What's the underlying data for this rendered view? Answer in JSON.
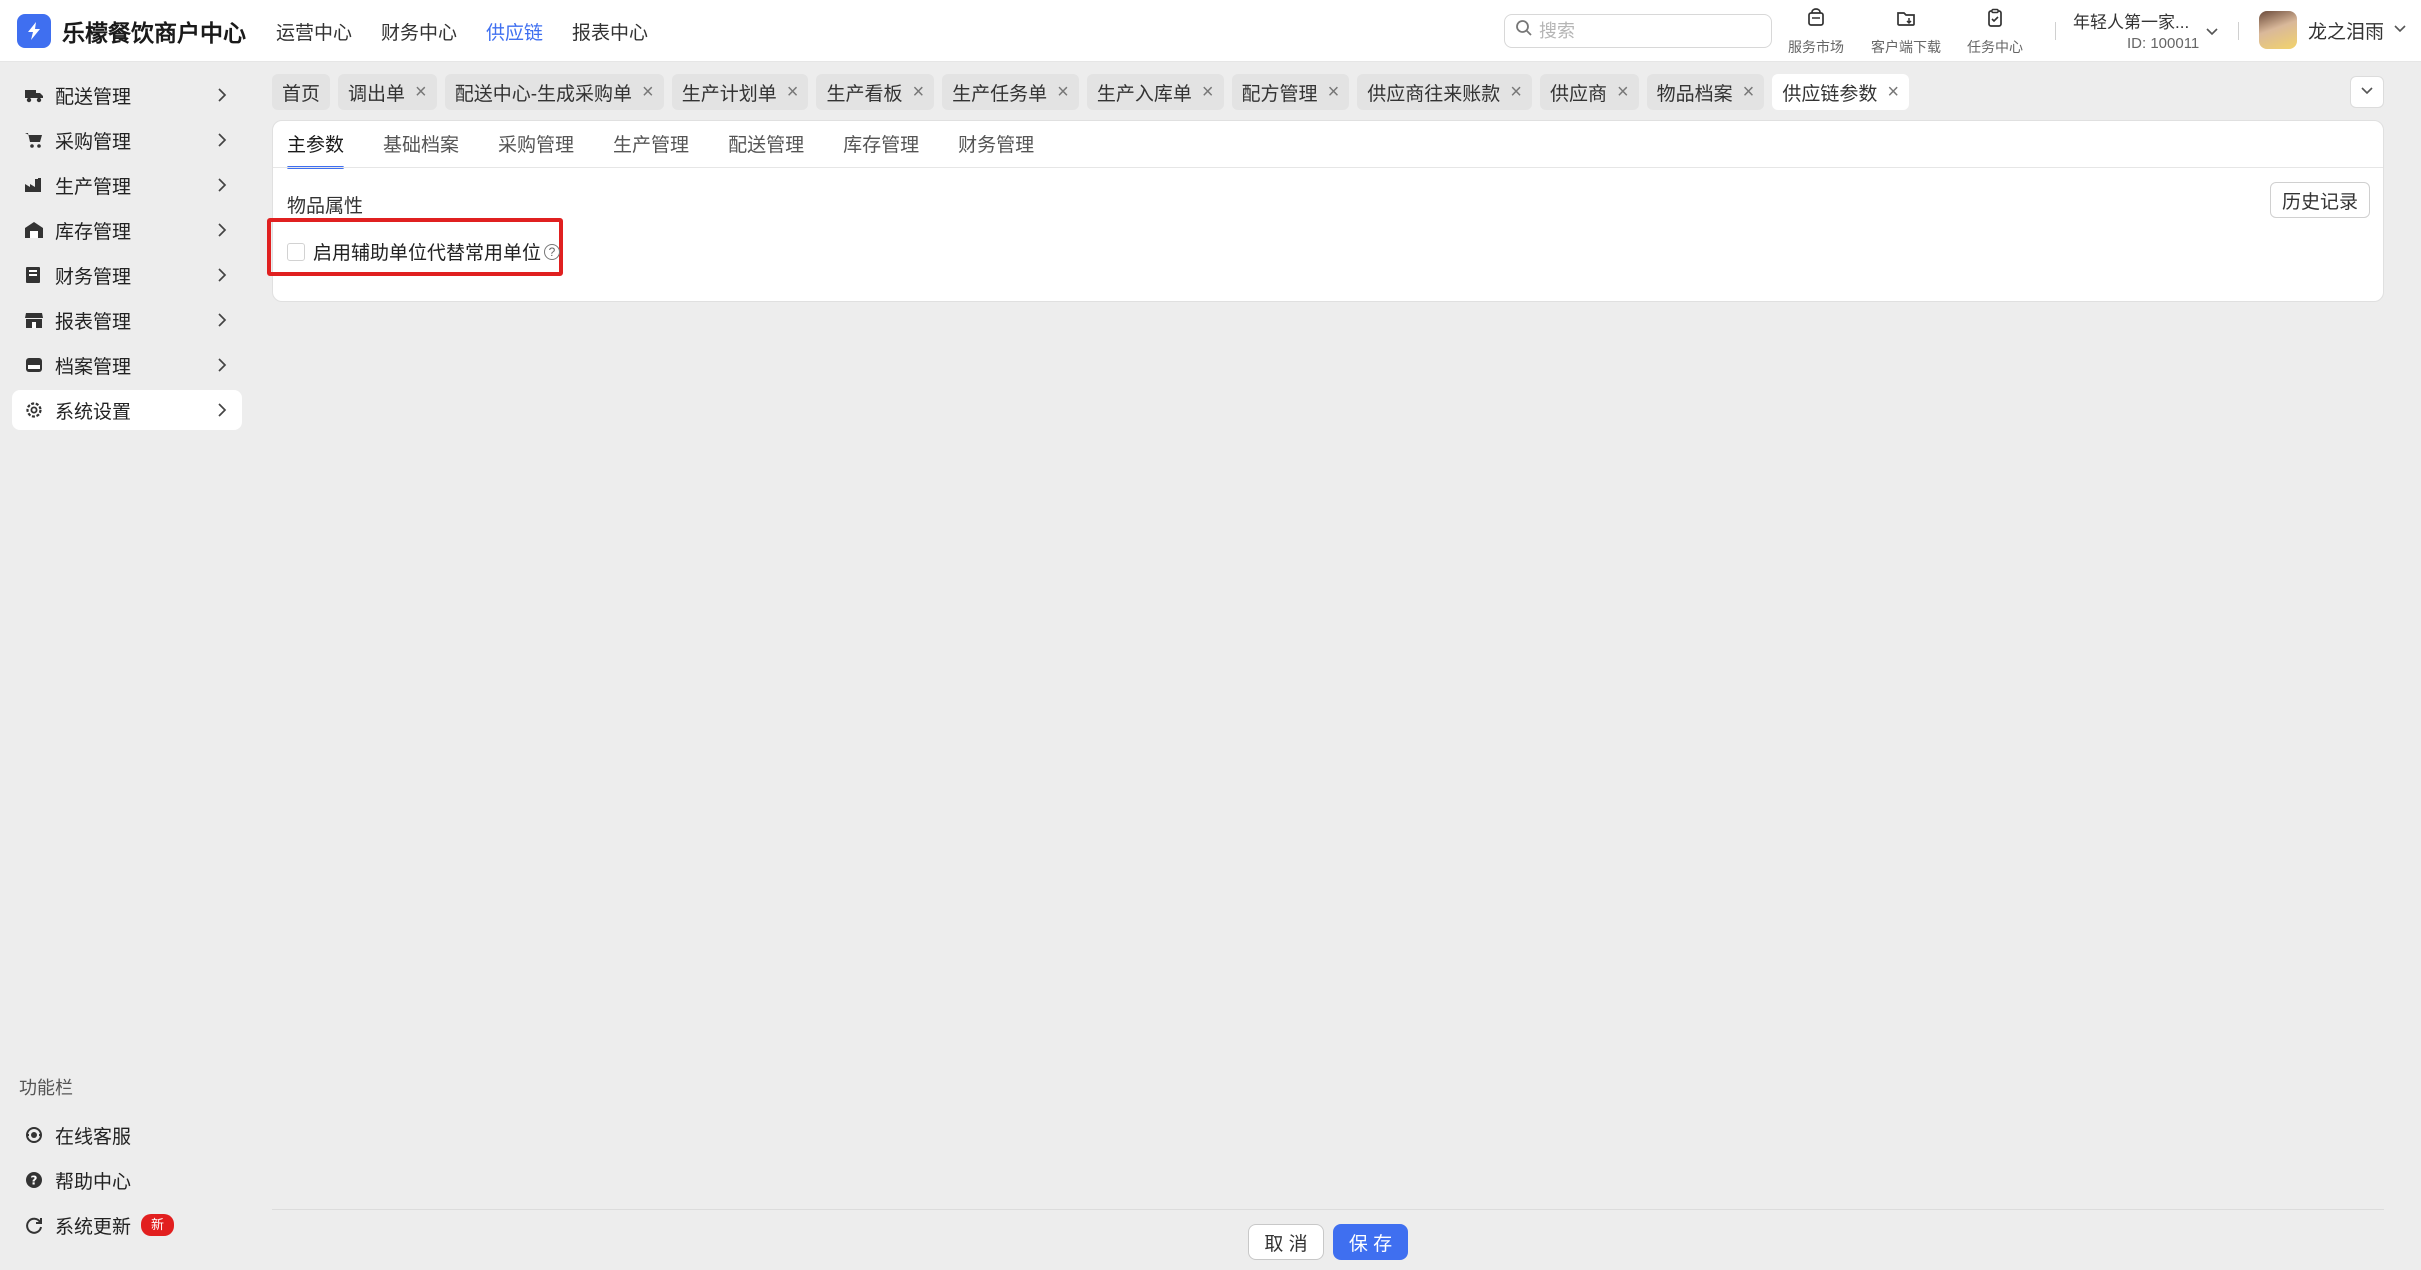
{
  "app": {
    "title": "乐檬餐饮商户中心",
    "brand_color": "#3f6ff0",
    "logo_icon": "lemon-logo-icon"
  },
  "topnav": {
    "items": [
      {
        "label": "运营中心",
        "active": false
      },
      {
        "label": "财务中心",
        "active": false
      },
      {
        "label": "供应链",
        "active": true
      },
      {
        "label": "报表中心",
        "active": false
      }
    ]
  },
  "search": {
    "placeholder": "搜索",
    "value": ""
  },
  "tools": [
    {
      "label": "服务市场",
      "icon": "store-bag-icon"
    },
    {
      "label": "客户端下载",
      "icon": "folder-download-icon"
    },
    {
      "label": "任务中心",
      "icon": "clipboard-icon"
    }
  ],
  "store": {
    "name": "年轻人第一家...",
    "id": "ID: 100011"
  },
  "user": {
    "name": "龙之泪雨"
  },
  "sidebar": {
    "items": [
      {
        "label": "配送管理",
        "icon": "truck-icon",
        "active": false
      },
      {
        "label": "采购管理",
        "icon": "cart-icon",
        "active": false
      },
      {
        "label": "生产管理",
        "icon": "factory-icon",
        "active": false
      },
      {
        "label": "库存管理",
        "icon": "warehouse-icon",
        "active": false
      },
      {
        "label": "财务管理",
        "icon": "ledger-icon",
        "active": false
      },
      {
        "label": "报表管理",
        "icon": "shop-icon",
        "active": false
      },
      {
        "label": "档案管理",
        "icon": "archive-box-icon",
        "active": false
      },
      {
        "label": "系统设置",
        "icon": "gear-icon",
        "active": true
      }
    ],
    "func_title": "功能栏",
    "func_items": [
      {
        "label": "在线客服",
        "icon": "headset-icon"
      },
      {
        "label": "帮助中心",
        "icon": "help-circle-icon"
      },
      {
        "label": "系统更新",
        "icon": "refresh-icon",
        "badge": "新"
      }
    ]
  },
  "tabs": [
    {
      "label": "首页",
      "closable": false,
      "active": false
    },
    {
      "label": "调出单",
      "closable": true,
      "active": false
    },
    {
      "label": "配送中心-生成采购单",
      "closable": true,
      "active": false
    },
    {
      "label": "生产计划单",
      "closable": true,
      "active": false
    },
    {
      "label": "生产看板",
      "closable": true,
      "active": false
    },
    {
      "label": "生产任务单",
      "closable": true,
      "active": false
    },
    {
      "label": "生产入库单",
      "closable": true,
      "active": false
    },
    {
      "label": "配方管理",
      "closable": true,
      "active": false
    },
    {
      "label": "供应商往来账款",
      "closable": true,
      "active": false
    },
    {
      "label": "供应商",
      "closable": true,
      "active": false
    },
    {
      "label": "物品档案",
      "closable": true,
      "active": false
    },
    {
      "label": "供应链参数",
      "closable": true,
      "active": true
    }
  ],
  "subtabs": [
    {
      "label": "主参数",
      "active": true
    },
    {
      "label": "基础档案",
      "active": false
    },
    {
      "label": "采购管理",
      "active": false
    },
    {
      "label": "生产管理",
      "active": false
    },
    {
      "label": "配送管理",
      "active": false
    },
    {
      "label": "库存管理",
      "active": false
    },
    {
      "label": "财务管理",
      "active": false
    }
  ],
  "main": {
    "section_title": "物品属性",
    "history_label": "历史记录",
    "option_label": "启用辅助单位代替常用单位",
    "option_checked": false,
    "help_glyph": "?"
  },
  "footer": {
    "cancel_label": "取 消",
    "save_label": "保 存"
  }
}
